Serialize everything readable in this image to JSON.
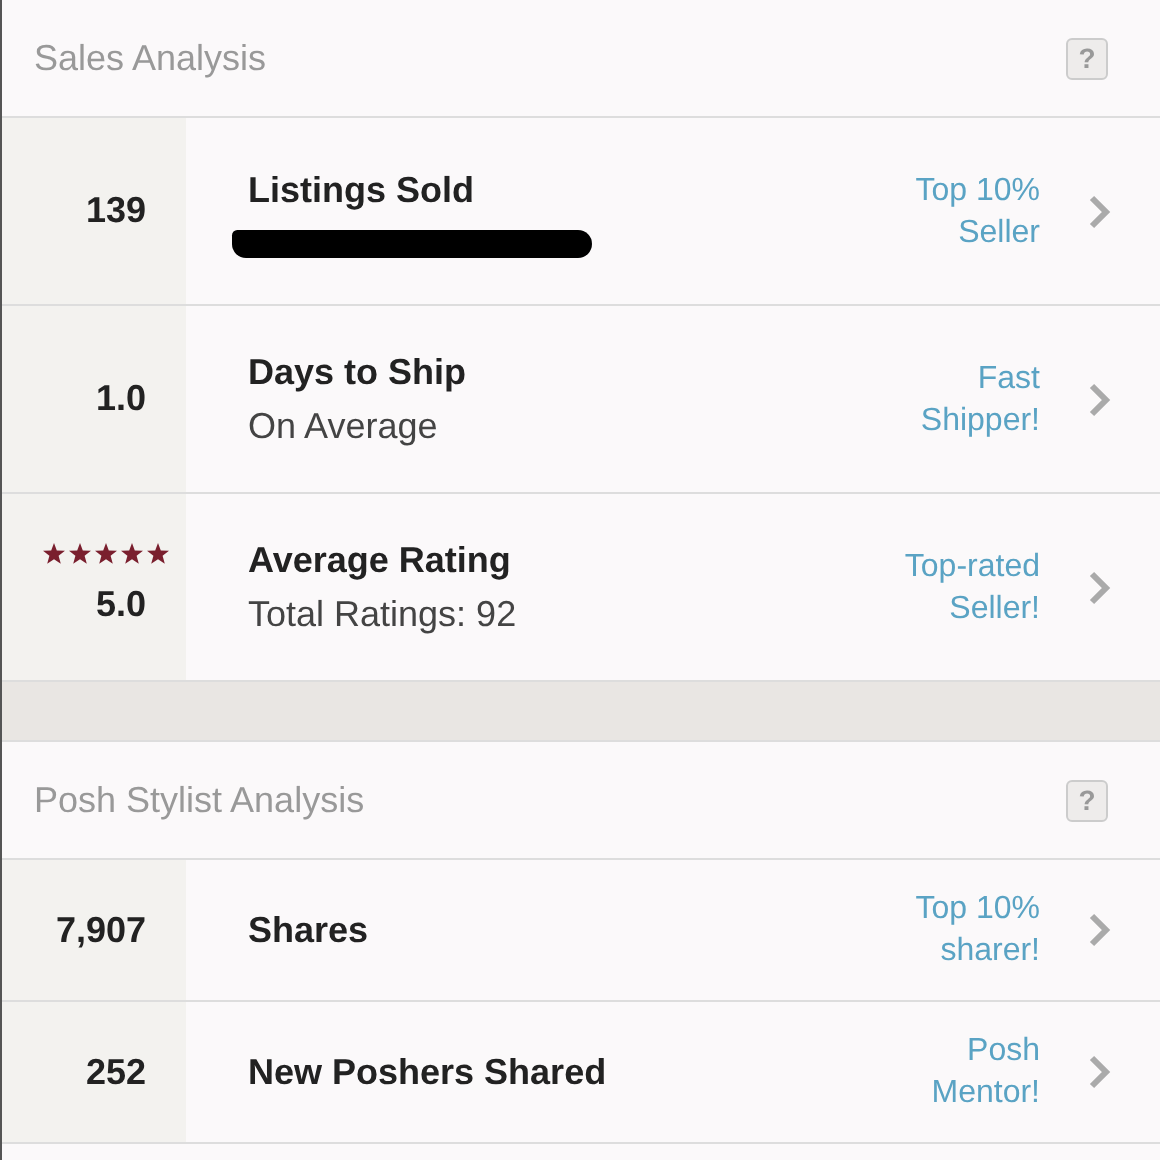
{
  "sections": [
    {
      "title": "Sales Analysis",
      "help": "?",
      "items": [
        {
          "value": "139",
          "title": "Listings Sold",
          "redacted": true,
          "badge": "Top 10%\nSeller"
        },
        {
          "value": "1.0",
          "title": "Days to Ship",
          "subtitle": "On Average",
          "badge": "Fast\nShipper!"
        },
        {
          "value": "5.0",
          "stars": 5,
          "title": "Average Rating",
          "subtitle": "Total Ratings: 92",
          "badge": "Top-rated\nSeller!"
        }
      ]
    },
    {
      "title": "Posh Stylist Analysis",
      "help": "?",
      "items": [
        {
          "value": "7,907",
          "title": "Shares",
          "badge": "Top 10%\nsharer!"
        },
        {
          "value": "252",
          "title": "New Poshers Shared",
          "badge": "Posh\nMentor!"
        }
      ]
    }
  ]
}
